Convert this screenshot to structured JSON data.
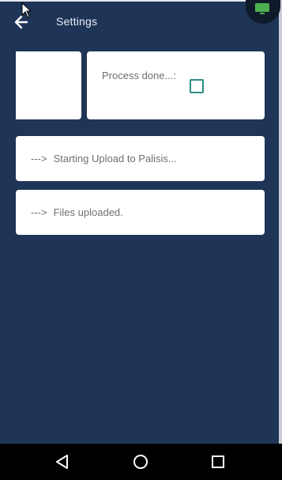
{
  "header": {
    "title": "Settings",
    "back_icon": "arrow-left-icon"
  },
  "fab": {
    "icon": "monitor-icon",
    "color": "#4caf50"
  },
  "process_card": {
    "label": "Process done...:",
    "checked": false,
    "checkbox_color": "#2d8c86"
  },
  "log": [
    {
      "prefix": "--->",
      "text": "Starting Upload to Palisis..."
    },
    {
      "prefix": "--->",
      "text": "Files uploaded."
    }
  ],
  "navbar": {
    "back_icon": "nav-back-icon",
    "home_icon": "nav-home-icon",
    "recents_icon": "nav-recents-icon"
  },
  "colors": {
    "background": "#1f3557",
    "card": "#ffffff",
    "navbar": "#000000"
  }
}
